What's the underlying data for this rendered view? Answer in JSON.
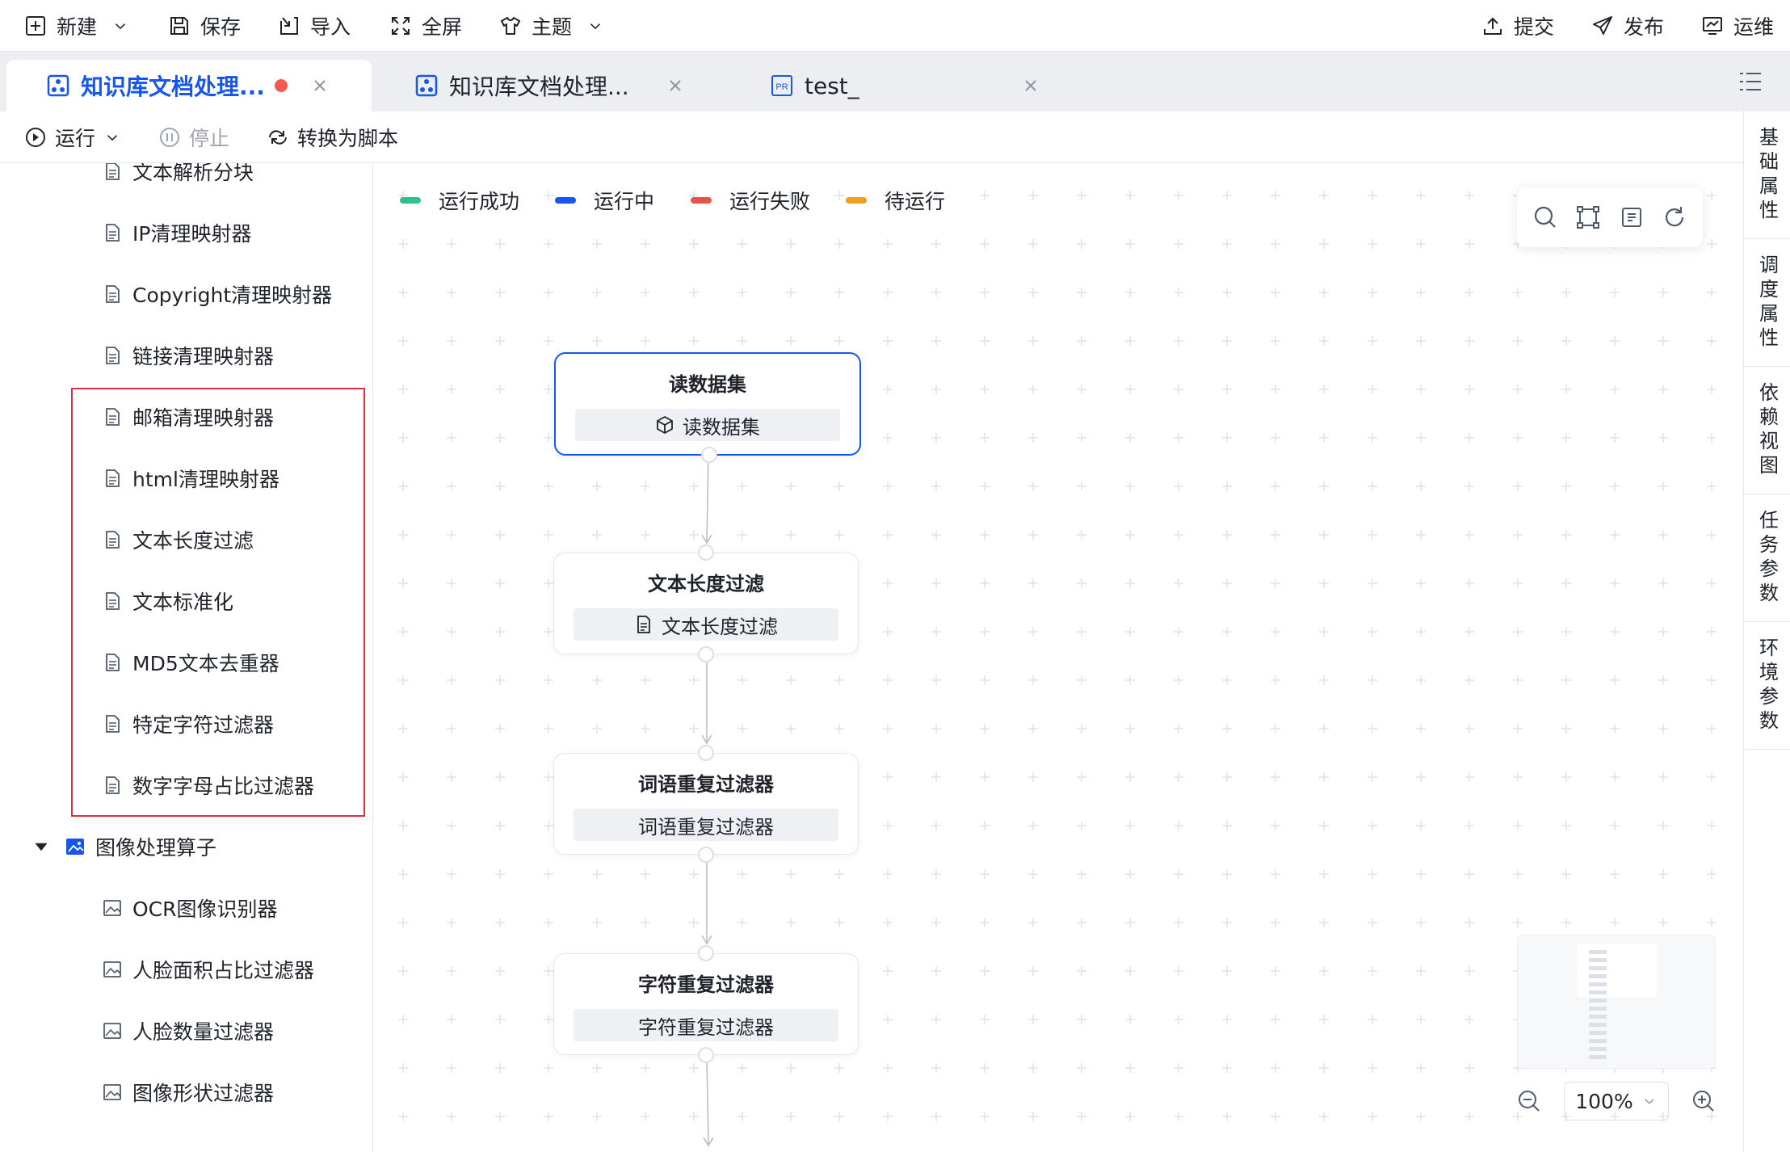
{
  "toolbar": {
    "new_label": "新建",
    "save_label": "保存",
    "import_label": "导入",
    "fullscreen_label": "全屏",
    "theme_label": "主题",
    "submit_label": "提交",
    "publish_label": "发布",
    "ops_label": "运维"
  },
  "tabs": [
    {
      "label": "知识库文档处理...",
      "active": true,
      "unsaved": true
    },
    {
      "label": "知识库文档处理...",
      "active": false
    },
    {
      "label": "test_",
      "active": false
    }
  ],
  "runbar": {
    "run_label": "运行",
    "stop_label": "停止",
    "convert_label": "转换为脚本"
  },
  "tree": {
    "items": [
      "文本解析分块",
      "IP清理映射器",
      "Copyright清理映射器",
      "链接清理映射器",
      "邮箱清理映射器",
      "html清理映射器",
      "文本长度过滤",
      "文本标准化",
      "MD5文本去重器",
      "特定字符过滤器",
      "数字字母占比过滤器"
    ],
    "group_label": "图像处理算子",
    "image_items": [
      "OCR图像识别器",
      "人脸面积占比过滤器",
      "人脸数量过滤器",
      "图像形状过滤器"
    ]
  },
  "legend": {
    "success": "运行成功",
    "running": "运行中",
    "failed": "运行失败",
    "pending": "待运行",
    "colors": {
      "success": "#2bc48a",
      "running": "#1456f0",
      "failed": "#e5534b",
      "pending": "#f0a020"
    }
  },
  "nodes": [
    {
      "title": "读数据集",
      "sub": "读数据集",
      "icon": "cube-icon"
    },
    {
      "title": "文本长度过滤",
      "sub": "文本长度过滤",
      "icon": "document-icon"
    },
    {
      "title": "词语重复过滤器",
      "sub": "词语重复过滤器"
    },
    {
      "title": "字符重复过滤器",
      "sub": "字符重复过滤器"
    }
  ],
  "zoom": {
    "value": "100%"
  },
  "rail": [
    "基础属性",
    "调度属性",
    "依赖视图",
    "任务参数",
    "环境参数"
  ],
  "accent_color": "#1456f0"
}
